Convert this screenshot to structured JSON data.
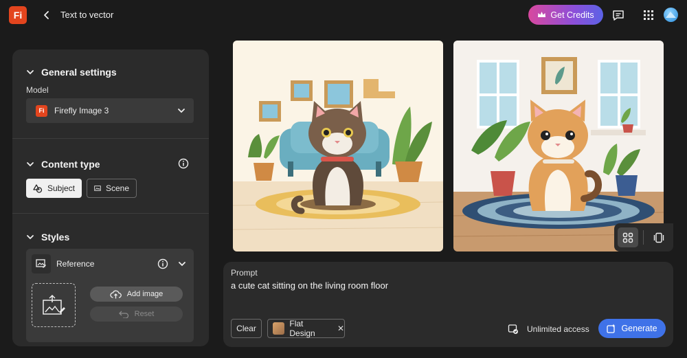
{
  "app": {
    "logo_text": "Fi",
    "page_title": "Text to vector"
  },
  "header": {
    "credits_label": "Get Credits"
  },
  "panel": {
    "general": {
      "title": "General settings",
      "model_label": "Model",
      "model_value": "Firefly Image 3",
      "model_icon_text": "Fi"
    },
    "content_type": {
      "title": "Content type",
      "options": [
        "Subject",
        "Scene"
      ],
      "selected": "Subject"
    },
    "styles": {
      "title": "Styles",
      "reference_label": "Reference",
      "add_image_label": "Add image",
      "reset_label": "Reset"
    }
  },
  "prompt": {
    "label": "Prompt",
    "text": "a cute cat sitting on the living room floor",
    "clear_label": "Clear",
    "style_chip": "Flat Design",
    "access_label": "Unlimited access",
    "generate_label": "Generate"
  },
  "colors": {
    "accent": "#3f72e8",
    "brand": "#e3451e",
    "credits_start": "#d8489e",
    "credits_end": "#5b62e6"
  }
}
